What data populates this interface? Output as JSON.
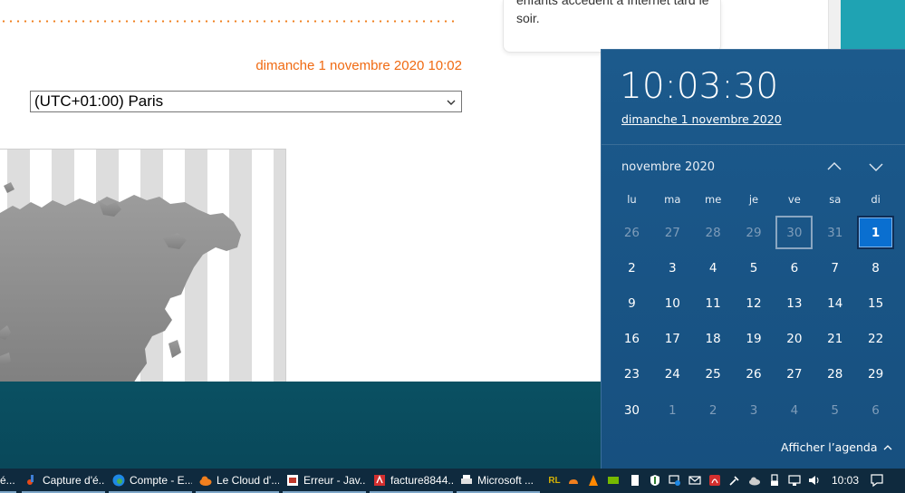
{
  "page": {
    "date_text": "dimanche 1 novembre 2020 10:02",
    "timezone_selected": "(UTC+01:00) Paris",
    "side_card_text_top": "enfants accèdent à Internet tard le",
    "side_card_text": "soir."
  },
  "calendar": {
    "time": "10:03:30",
    "full_date": "dimanche 1 novembre 2020",
    "month_label": "novembre 2020",
    "weekdays": [
      "lu",
      "ma",
      "me",
      "je",
      "ve",
      "sa",
      "di"
    ],
    "days": [
      {
        "d": "26",
        "muted": true
      },
      {
        "d": "27",
        "muted": true
      },
      {
        "d": "28",
        "muted": true
      },
      {
        "d": "29",
        "muted": true
      },
      {
        "d": "30",
        "muted": true,
        "outlined": true
      },
      {
        "d": "31",
        "muted": true
      },
      {
        "d": "1",
        "selected": true
      },
      {
        "d": "2"
      },
      {
        "d": "3"
      },
      {
        "d": "4"
      },
      {
        "d": "5"
      },
      {
        "d": "6"
      },
      {
        "d": "7"
      },
      {
        "d": "8"
      },
      {
        "d": "9"
      },
      {
        "d": "10"
      },
      {
        "d": "11"
      },
      {
        "d": "12"
      },
      {
        "d": "13"
      },
      {
        "d": "14"
      },
      {
        "d": "15"
      },
      {
        "d": "16"
      },
      {
        "d": "17"
      },
      {
        "d": "18"
      },
      {
        "d": "19"
      },
      {
        "d": "20"
      },
      {
        "d": "21"
      },
      {
        "d": "22"
      },
      {
        "d": "23"
      },
      {
        "d": "24"
      },
      {
        "d": "25"
      },
      {
        "d": "26"
      },
      {
        "d": "27"
      },
      {
        "d": "28"
      },
      {
        "d": "29"
      },
      {
        "d": "30"
      },
      {
        "d": "1",
        "muted": true
      },
      {
        "d": "2",
        "muted": true
      },
      {
        "d": "3",
        "muted": true
      },
      {
        "d": "4",
        "muted": true
      },
      {
        "d": "5",
        "muted": true
      },
      {
        "d": "6",
        "muted": true
      }
    ],
    "agenda_label": "Afficher l’agenda",
    "colors": {
      "accent": "#0a6fd0",
      "flyout_bg": "#1a5688",
      "muted_day": "#7e9cb9"
    }
  },
  "taskbar": {
    "apps": [
      {
        "label": "é...",
        "icon": "app-icon"
      },
      {
        "label": "Capture d'é...",
        "icon": "snip-icon"
      },
      {
        "label": "Compte - E...",
        "icon": "edge-icon"
      },
      {
        "label": "Le Cloud d'...",
        "icon": "cloud-icon"
      },
      {
        "label": "Erreur - Jav...",
        "icon": "java-icon"
      },
      {
        "label": "facture8844...",
        "icon": "pdf-icon"
      },
      {
        "label": "Microsoft ...",
        "icon": "printer-icon"
      }
    ],
    "tray_rl": "RL",
    "time": "10:03"
  }
}
